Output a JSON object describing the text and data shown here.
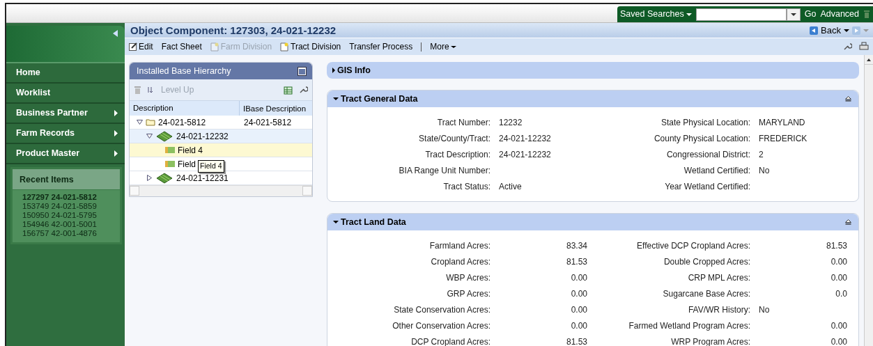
{
  "top_bar": {
    "saved_searches": "Saved Searches",
    "go": "Go",
    "advanced": "Advanced"
  },
  "sidebar": {
    "menu": [
      {
        "label": "Home",
        "submenu": false
      },
      {
        "label": "Worklist",
        "submenu": false
      },
      {
        "label": "Business Partner",
        "submenu": true
      },
      {
        "label": "Farm Records",
        "submenu": true
      },
      {
        "label": "Product Master",
        "submenu": true
      }
    ],
    "recent_items": {
      "title": "Recent Items",
      "items": [
        {
          "label": "127297 24-021-5812",
          "selected": true
        },
        {
          "label": "153749 24-021-5859",
          "selected": false
        },
        {
          "label": "150950 24-021-5795",
          "selected": false
        },
        {
          "label": "154946 42-001-5001",
          "selected": false
        },
        {
          "label": "156757 42-001-4876",
          "selected": false
        }
      ]
    }
  },
  "title": "Object Component: 127303, 24-021-12232",
  "nav": {
    "back": "Back"
  },
  "toolbar": [
    {
      "label": "Edit",
      "kind": "edit",
      "disabled": false
    },
    {
      "label": "Fact Sheet",
      "kind": "plain",
      "disabled": false
    },
    {
      "label": "Farm Division",
      "kind": "division",
      "disabled": true
    },
    {
      "label": "Tract Division",
      "kind": "division",
      "disabled": false
    },
    {
      "label": "Transfer Process",
      "kind": "plain",
      "disabled": false
    },
    {
      "label": "More",
      "kind": "menu",
      "disabled": false
    }
  ],
  "hierarchy": {
    "title": "Installed Base Hierarchy",
    "level_up": "Level Up",
    "columns": [
      "Description",
      "IBase Description"
    ],
    "tree": [
      {
        "label": "24-021-5812",
        "ibase": "24-021-5812",
        "kind": "folder",
        "expanded": true,
        "selected": false,
        "current": false,
        "children": [
          {
            "label": "24-021-12232",
            "kind": "tract",
            "expanded": true,
            "selected": false,
            "current": true,
            "children": [
              {
                "label": "Field 4",
                "kind": "field",
                "selected": true,
                "current": false
              },
              {
                "label": "Field",
                "kind": "field",
                "selected": false,
                "current": false
              }
            ]
          },
          {
            "label": "24-021-12231",
            "kind": "tract",
            "expanded": false,
            "selected": false,
            "current": false
          }
        ]
      }
    ],
    "tooltip": "Field 4"
  },
  "sections": [
    {
      "title": "GIS Info",
      "expanded": false
    },
    {
      "title": "Tract General Data",
      "expanded": true,
      "kind": "text",
      "left": [
        {
          "label": "Tract Number:",
          "value": "12232"
        },
        {
          "label": "State/County/Tract:",
          "value": "24-021-12232"
        },
        {
          "label": "Tract Description:",
          "value": "24-021-12232"
        },
        {
          "label": "BIA Range Unit Number:"
        },
        {
          "label": "Tract Status:",
          "value": "Active"
        }
      ],
      "right": [
        {
          "label": "State Physical Location:",
          "value": "MARYLAND"
        },
        {
          "label": "County Physical Location:",
          "value": "FREDERICK"
        },
        {
          "label": "Congressional District:",
          "value": "2"
        },
        {
          "label": "Wetland Certified:",
          "value": "No"
        },
        {
          "label": "Year Wetland Certified:"
        }
      ]
    },
    {
      "title": "Tract Land Data",
      "expanded": true,
      "kind": "numeric",
      "left": [
        {
          "label": "Farmland Acres:",
          "value": "83.34"
        },
        {
          "label": "Cropland Acres:",
          "value": "81.53"
        },
        {
          "label": "WBP Acres:",
          "value": "0.00"
        },
        {
          "label": "GRP Acres:",
          "value": "0.00"
        },
        {
          "label": "State Conservation Acres:",
          "value": "0.00"
        },
        {
          "label": "Other Conservation Acres:",
          "value": "0.00"
        },
        {
          "label": "DCP Cropland Acres:",
          "value": "81.53"
        }
      ],
      "right": [
        {
          "label": "Effective DCP Cropland Acres:",
          "value": "81.53"
        },
        {
          "label": "Double Cropped Acres:",
          "value": "0.00"
        },
        {
          "label": "CRP MPL Acres:",
          "value": "0.00"
        },
        {
          "label": "Sugarcane Base Acres:",
          "value": "0.0"
        },
        {
          "label": "FAV/WR History:",
          "value": "No",
          "text": true
        },
        {
          "label": "Farmed Wetland Program Acres:",
          "value": "0.00"
        },
        {
          "label": "WRP Program Acres:",
          "value": "0.00"
        }
      ]
    }
  ]
}
